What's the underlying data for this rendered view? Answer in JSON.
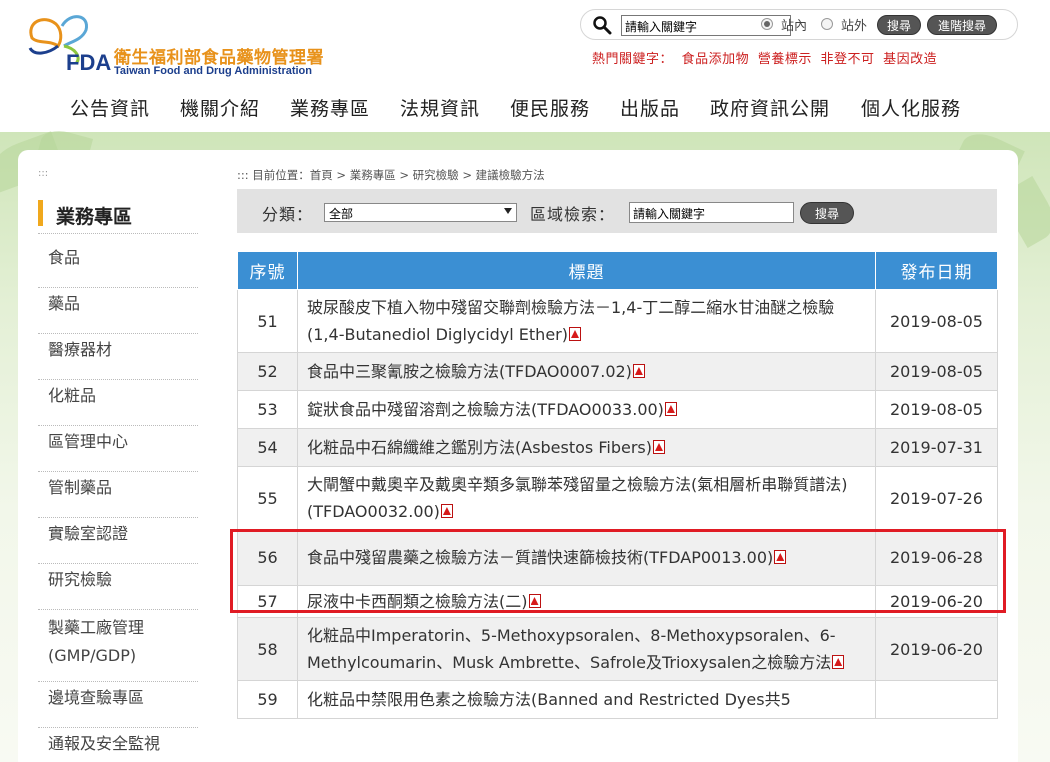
{
  "header": {
    "logo_cn": "衛生福利部食品藥物管理署",
    "logo_en": "Taiwan Food and Drug Administration",
    "logo_fda": "FDA",
    "search": {
      "placeholder": "請輸入關鍵字",
      "value": "請輸入關鍵字",
      "radio_site_in": "站內",
      "radio_site_out": "站外",
      "search_button": "搜尋",
      "advanced_button": "進階搜尋"
    },
    "hot_keywords": {
      "label": "熱門關鍵字：",
      "items": [
        "食品添加物",
        "營養標示",
        "非登不可",
        "基因改造"
      ]
    },
    "nav": [
      "公告資訊",
      "機關介紹",
      "業務專區",
      "法規資訊",
      "便民服務",
      "出版品",
      "政府資訊公開",
      "個人化服務"
    ]
  },
  "sidebar": {
    "dots": ":::",
    "title": "業務專區",
    "items": [
      "食品",
      "藥品",
      "醫療器材",
      "化粧品",
      "區管理中心",
      "管制藥品",
      "實驗室認證",
      "研究檢驗",
      "製藥工廠管理(GMP/GDP)",
      "邊境查驗專區",
      "通報及安全監視"
    ]
  },
  "main": {
    "breadcrumb": "::: 目前位置：首頁 > 業務專區 > 研究檢驗 > 建議檢驗方法",
    "filter": {
      "category_label": "分類：",
      "category_value": "全部",
      "area_label": "區域檢索：",
      "keyword_placeholder": "請輸入關鍵字",
      "search_button": "搜尋"
    },
    "table": {
      "headers": [
        "序號",
        "標題",
        "發布日期"
      ],
      "rows": [
        {
          "num": "51",
          "title": "玻尿酸皮下植入物中殘留交聯劑檢驗方法－1,4-丁二醇二縮水甘油醚之檢驗(1,4-Butanediol Diglycidyl Ether)",
          "date": "2019-08-05"
        },
        {
          "num": "52",
          "title": "食品中三聚氰胺之檢驗方法(TFDAO0007.02)",
          "date": "2019-08-05"
        },
        {
          "num": "53",
          "title": "錠狀食品中殘留溶劑之檢驗方法(TFDAO0033.00)",
          "date": "2019-08-05"
        },
        {
          "num": "54",
          "title": "化粧品中石綿纖維之鑑別方法(Asbestos Fibers)",
          "date": "2019-07-31"
        },
        {
          "num": "55",
          "title": "大閘蟹中戴奧辛及戴奧辛類多氯聯苯殘留量之檢驗方法(氣相層析串聯質譜法)(TFDAO0032.00)",
          "date": "2019-07-26"
        },
        {
          "num": "56",
          "title": "食品中殘留農藥之檢驗方法－質譜快速篩檢技術(TFDAP0013.00)",
          "date": "2019-06-28"
        },
        {
          "num": "57",
          "title": "尿液中卡西酮類之檢驗方法(二)",
          "date": "2019-06-20"
        },
        {
          "num": "58",
          "title": "化粧品中Imperatorin、5-Methoxypsoralen、8-Methoxypsoralen、6-Methylcoumarin、Musk Ambrette、Safrole及Trioxysalen之檢驗方法",
          "date": "2019-06-20"
        },
        {
          "num": "59",
          "title": "化粧品中禁限用色素之檢驗方法(Banned and Restricted Dyes共5",
          "date": ""
        }
      ]
    }
  },
  "colors": {
    "accent_blue": "#3b8fd3",
    "highlight_red": "#e01b24",
    "logo_orange": "#e8921b",
    "logo_blue": "#1c3f8d",
    "hot_keyword_red": "#cc2020",
    "sidebar_bar": "#f0a81d"
  }
}
